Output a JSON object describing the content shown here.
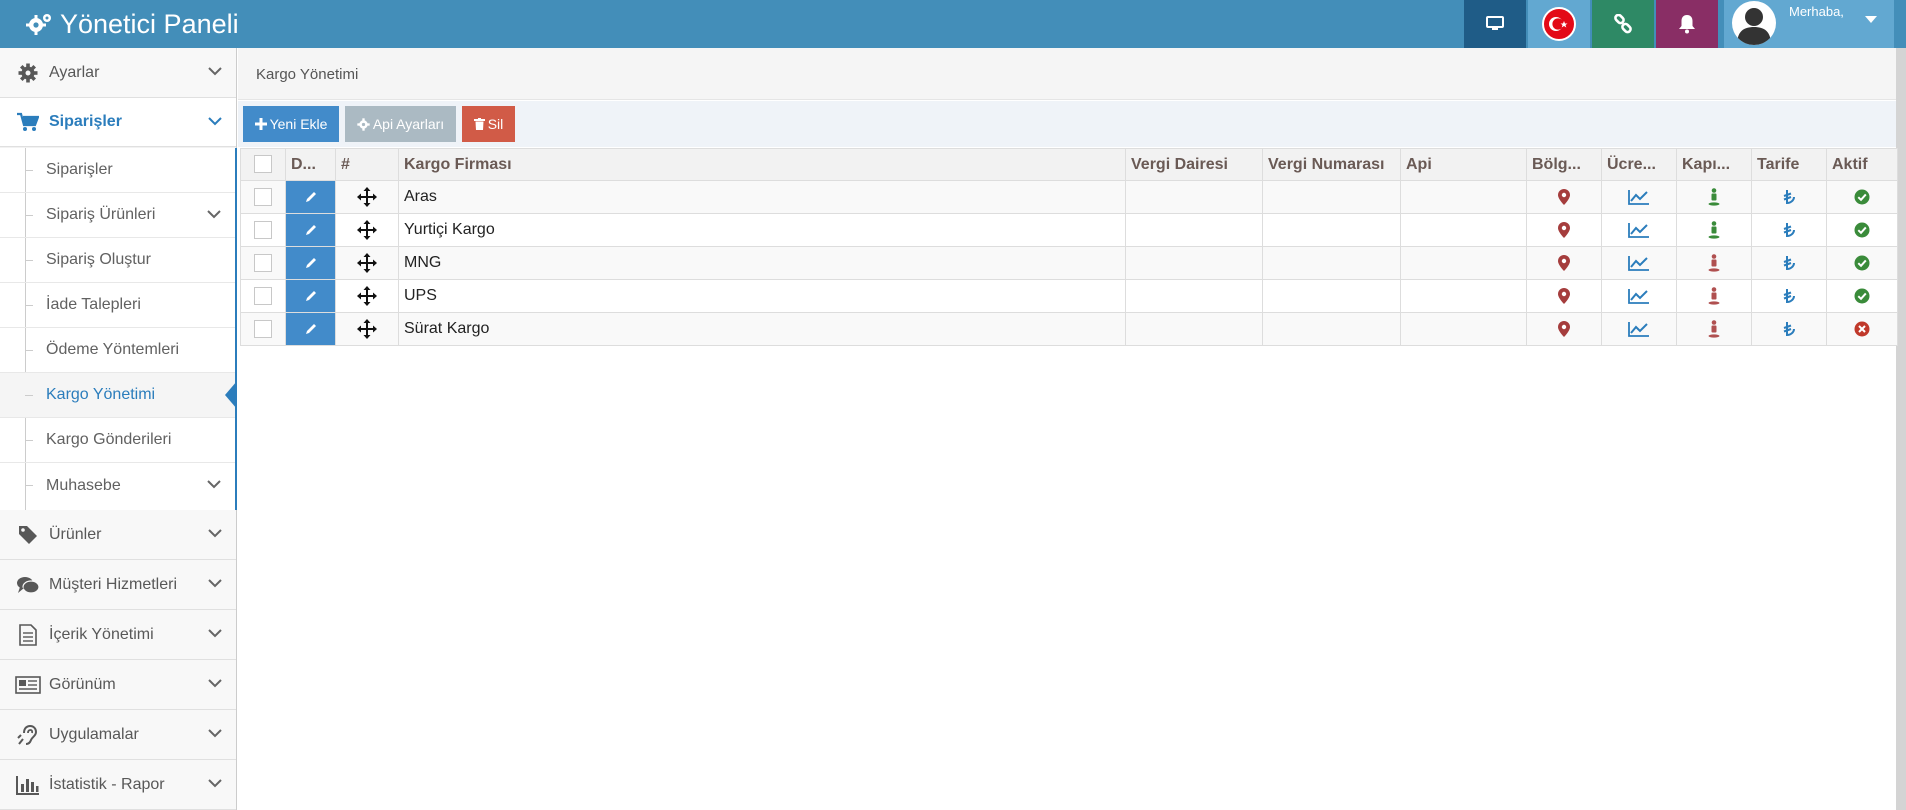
{
  "header": {
    "title": "Yönetici Paneli",
    "greeting": "Merhaba,",
    "buttons": [
      {
        "icon": "monitor-icon",
        "color": "#1f5c87"
      },
      {
        "icon": "turkey-flag-icon",
        "color": "#62a8d1"
      },
      {
        "icon": "link-icon",
        "color": "#2e8965"
      },
      {
        "icon": "bell-icon",
        "color": "#892e65"
      }
    ]
  },
  "sidebar": {
    "items": [
      {
        "label": "Ayarlar",
        "icon": "gear-icon"
      },
      {
        "label": "Siparişler",
        "icon": "cart-icon"
      },
      {
        "label": "Ürünler",
        "icon": "tag-icon"
      },
      {
        "label": "Müşteri Hizmetleri",
        "icon": "comments-icon"
      },
      {
        "label": "İçerik Yönetimi",
        "icon": "document-icon"
      },
      {
        "label": "Görünüm",
        "icon": "newspaper-icon"
      },
      {
        "label": "Uygulamalar",
        "icon": "hearing-icon"
      },
      {
        "label": "İstatistik - Rapor",
        "icon": "bar-chart-icon"
      }
    ],
    "submenu": [
      {
        "label": "Siparişler"
      },
      {
        "label": "Sipariş Ürünleri"
      },
      {
        "label": "Sipariş Oluştur"
      },
      {
        "label": "İade Talepleri"
      },
      {
        "label": "Ödeme Yöntemleri"
      },
      {
        "label": "Kargo Yönetimi"
      },
      {
        "label": "Kargo Gönderileri"
      },
      {
        "label": "Muhasebe"
      }
    ]
  },
  "breadcrumb": "Kargo Yönetimi",
  "toolbar": {
    "add": "Yeni Ekle",
    "api": "Api Ayarları",
    "delete": "Sil"
  },
  "table": {
    "columns": [
      "D...",
      "#",
      "Kargo Firması",
      "Vergi Dairesi",
      "Vergi Numarası",
      "Api",
      "Bölg...",
      "Ücre...",
      "Kapı...",
      "Tarife",
      "Aktif"
    ],
    "rows": [
      {
        "name": "Aras",
        "door": "green",
        "active": true
      },
      {
        "name": "Yurtiçi Kargo",
        "door": "green",
        "active": true
      },
      {
        "name": "MNG",
        "door": "red",
        "active": true
      },
      {
        "name": "UPS",
        "door": "red",
        "active": true
      },
      {
        "name": "Sürat Kargo",
        "door": "red",
        "active": false
      }
    ]
  },
  "colors": {
    "header": "#438eb9",
    "primary": "#428bca",
    "danger": "#d15b47",
    "grey_button": "#abbac3",
    "success": "#3a8b3a",
    "marker": "#a53d3d",
    "lira": "#2b7dbc"
  }
}
